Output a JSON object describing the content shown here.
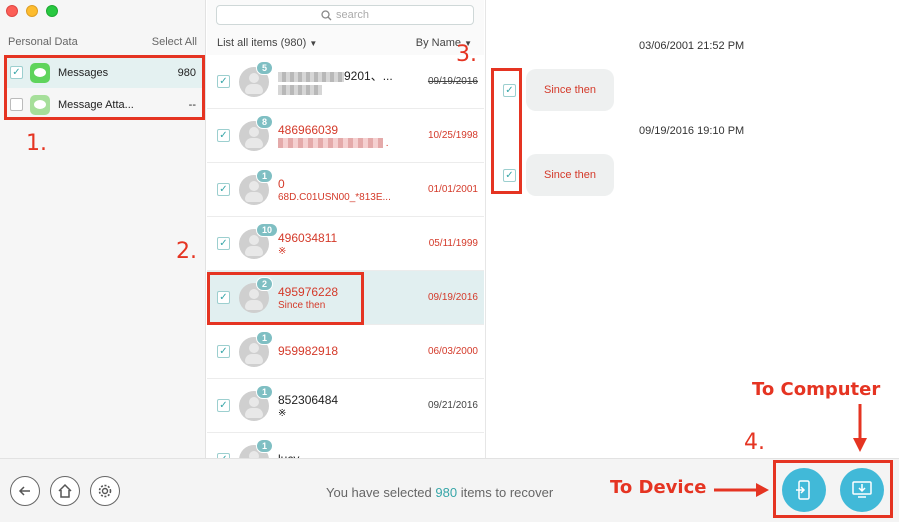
{
  "left": {
    "header_title": "Personal Data",
    "select_all": "Select All",
    "categories": [
      {
        "label": "Messages",
        "count": "980",
        "checked": true
      },
      {
        "label": "Message Atta...",
        "count": "--",
        "checked": false
      }
    ]
  },
  "mid": {
    "search_placeholder": "search",
    "list_filter": "List all items (980)",
    "sort": "By Name",
    "rows": [
      {
        "badge": "5",
        "name": "9201、...",
        "sub": "",
        "date": "09/19/2016",
        "red": false
      },
      {
        "badge": "8",
        "name": "486966039",
        "sub": ".",
        "date": "10/25/1998",
        "red": true
      },
      {
        "badge": "1",
        "name": "0",
        "sub": "68D.C01USN00_*813E...",
        "date": "01/01/2001",
        "red": true
      },
      {
        "badge": "10",
        "name": "496034811",
        "sub": "※",
        "date": "05/11/1999",
        "red": true
      },
      {
        "badge": "2",
        "name": "495976228",
        "sub": "Since then",
        "date": "09/19/2016",
        "red": true
      },
      {
        "badge": "1",
        "name": "959982918",
        "sub": "",
        "date": "06/03/2000",
        "red": true
      },
      {
        "badge": "1",
        "name": "852306484",
        "sub": "※",
        "date": "09/21/2016",
        "red": false
      },
      {
        "badge": "1",
        "name": "lucy",
        "sub": "",
        "date": "",
        "red": false
      }
    ]
  },
  "conversation": {
    "messages": [
      {
        "timestamp": "03/06/2001 21:52 PM",
        "text": "Since then"
      },
      {
        "timestamp": "09/19/2016 19:10 PM",
        "text": "Since then"
      }
    ]
  },
  "bottom": {
    "status_prefix": "You have selected ",
    "status_count": "980",
    "status_suffix": " items to recover"
  },
  "annotations": {
    "step1": "1.",
    "step2": "2.",
    "step3": "3.",
    "step4": "4.",
    "to_device": "To Device",
    "to_computer": "To Computer"
  },
  "colors": {
    "accent": "#37a6a8",
    "annotation": "#e53422",
    "recover_button": "#41b9d8",
    "highlight_red": "#d43a2a"
  }
}
